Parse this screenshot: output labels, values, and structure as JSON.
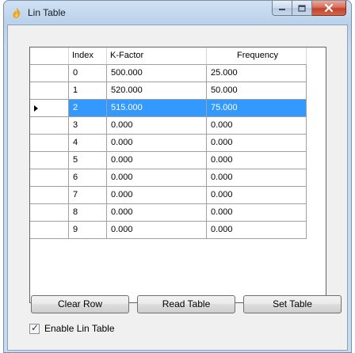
{
  "window": {
    "title": "Lin Table"
  },
  "grid": {
    "columns": [
      "Index",
      "K-Factor",
      "Frequency"
    ],
    "rows": [
      {
        "index": "0",
        "kfactor": "500.000",
        "frequency": "25.000"
      },
      {
        "index": "1",
        "kfactor": "520.000",
        "frequency": "50.000"
      },
      {
        "index": "2",
        "kfactor": "515.000",
        "frequency": "75.000"
      },
      {
        "index": "3",
        "kfactor": "0.000",
        "frequency": "0.000"
      },
      {
        "index": "4",
        "kfactor": "0.000",
        "frequency": "0.000"
      },
      {
        "index": "5",
        "kfactor": "0.000",
        "frequency": "0.000"
      },
      {
        "index": "6",
        "kfactor": "0.000",
        "frequency": "0.000"
      },
      {
        "index": "7",
        "kfactor": "0.000",
        "frequency": "0.000"
      },
      {
        "index": "8",
        "kfactor": "0.000",
        "frequency": "0.000"
      },
      {
        "index": "9",
        "kfactor": "0.000",
        "frequency": "0.000"
      }
    ],
    "selected_row": 2
  },
  "buttons": {
    "clear_row": "Clear Row",
    "read_table": "Read Table",
    "set_table": "Set Table"
  },
  "options": {
    "enable_lin_table": {
      "label": "Enable Lin Table",
      "checked": true
    }
  },
  "icons": {
    "app": "flame-icon",
    "minimize": "minimize-icon",
    "maximize": "maximize-icon",
    "close": "close-icon",
    "row_selector": "row-arrow-icon",
    "check": "check-icon"
  },
  "colors": {
    "selection": "#3399ff",
    "close_button": "#c3432a"
  }
}
